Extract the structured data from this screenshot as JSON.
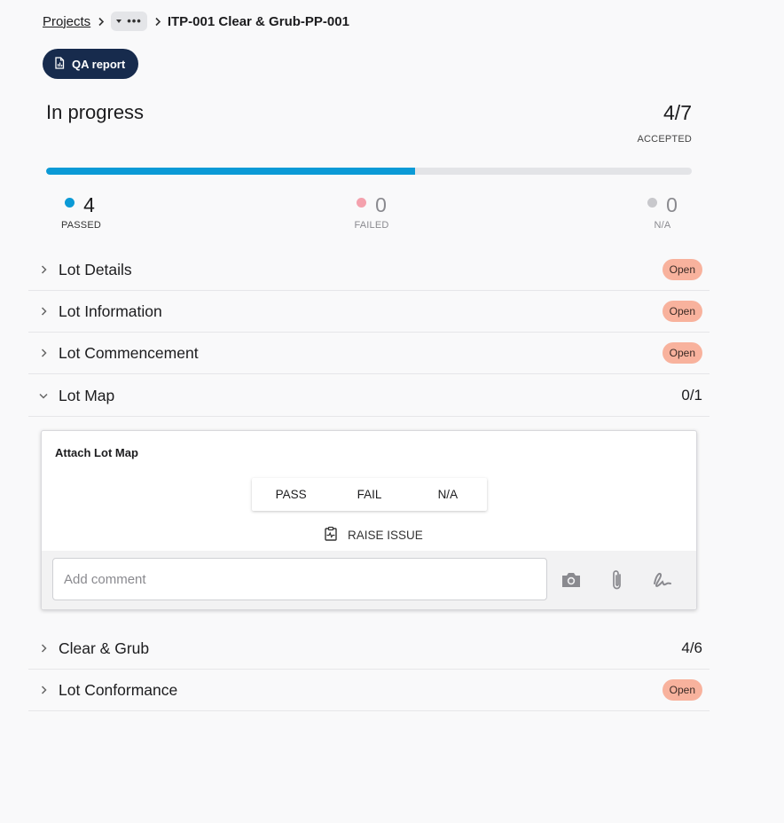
{
  "breadcrumb": {
    "projects": "Projects",
    "current": "ITP-001 Clear & Grub-PP-001"
  },
  "qa_report": {
    "label": "QA report"
  },
  "status": {
    "title": "In progress",
    "accepted_ratio": "4/7",
    "accepted_label": "ACCEPTED",
    "progress_fraction": 0.571
  },
  "stats": {
    "passed": {
      "value": "4",
      "label": "PASSED",
      "color": "#0b9ad6"
    },
    "failed": {
      "value": "0",
      "label": "FAILED",
      "color": "#f4a1ad"
    },
    "na": {
      "value": "0",
      "label": "N/A",
      "color": "#c8c8cc"
    }
  },
  "sections": [
    {
      "title": "Lot Details",
      "status": "Open",
      "expanded": false
    },
    {
      "title": "Lot Information",
      "status": "Open",
      "expanded": false
    },
    {
      "title": "Lot Commencement",
      "status": "Open",
      "expanded": false
    },
    {
      "title": "Lot Map",
      "count": "0/1",
      "expanded": true
    },
    {
      "title": "Clear & Grub",
      "count": "4/6",
      "expanded": false
    },
    {
      "title": "Lot Conformance",
      "status": "Open",
      "expanded": false
    }
  ],
  "card": {
    "title": "Attach Lot Map",
    "pass": "PASS",
    "fail": "FAIL",
    "na": "N/A",
    "raise_issue": "RAISE ISSUE",
    "comment_placeholder": "Add comment"
  },
  "icons": {
    "qa": "report-icon",
    "raise": "clipboard-pulse-icon",
    "camera": "camera-icon",
    "attach": "paperclip-icon",
    "signature": "signature-icon"
  }
}
